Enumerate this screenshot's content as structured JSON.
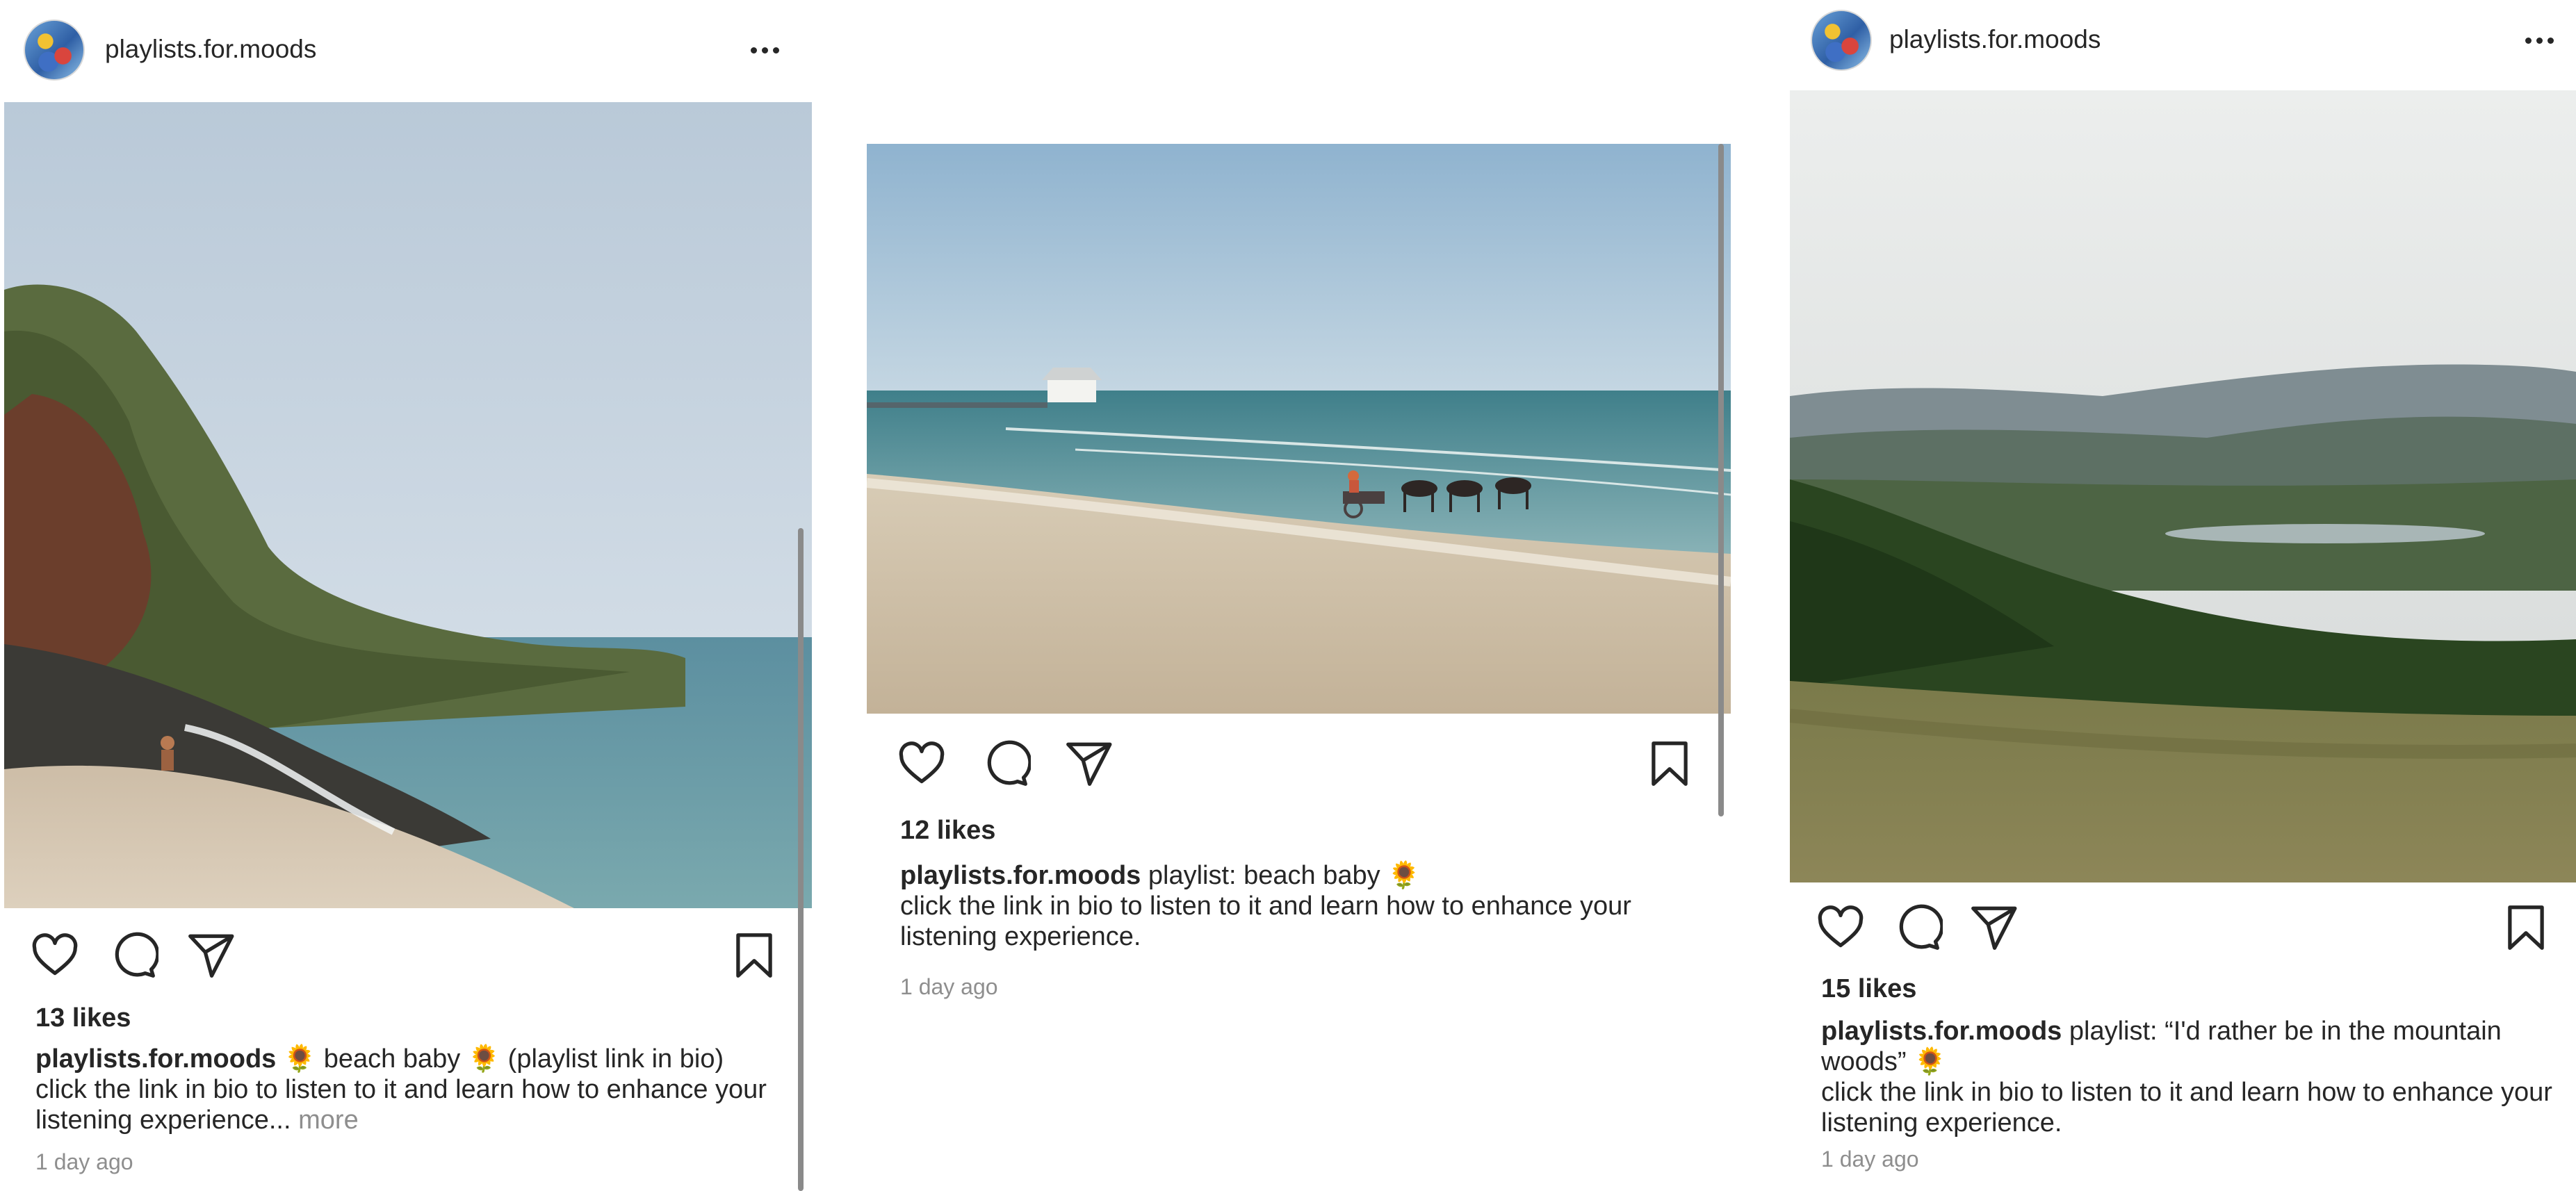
{
  "posts": [
    {
      "username": "playlists.for.moods",
      "likes": "13 likes",
      "caption_user": "playlists.for.moods",
      "caption_title": "🌻 beach baby 🌻 (playlist link in bio)",
      "caption_body": "click the link in bio to listen to it and learn how to enhance your listening experience...",
      "more_label": "more",
      "time": "1 day ago",
      "photo": "beach cove with cliffs and swimmer"
    },
    {
      "username": "",
      "likes": "12 likes",
      "caption_user": "playlists.for.moods",
      "caption_title": "playlist: beach baby 🌻",
      "caption_body": "click the link in bio to listen to it and learn how to enhance your listening experience.",
      "time": "1 day ago",
      "photo": "sandy beach with horse-drawn cart in the sea"
    },
    {
      "username": "playlists.for.moods",
      "likes": "15 likes",
      "caption_user": "playlists.for.moods",
      "caption_title": "playlist: “I'd rather be in the mountain woods” 🌻",
      "caption_body": "click the link in bio to listen to it and learn how to enhance your listening experience.",
      "time": "1 day ago",
      "photo": "green hills and mountain valley with lake"
    }
  ],
  "icons": {
    "like": "heart-icon",
    "comment": "comment-icon",
    "share": "send-icon",
    "save": "bookmark-icon",
    "options": "more-options-icon"
  },
  "colors": {
    "text": "#262626",
    "muted": "#8e8e8e",
    "background": "#ffffff"
  }
}
